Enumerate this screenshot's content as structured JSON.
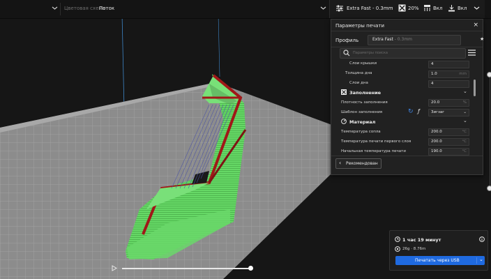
{
  "topbar": {
    "color_scheme_label": "Цветовая схема",
    "color_scheme_value": "Поток",
    "profile_summary": "Extra Fast - 0.3mm",
    "infill": "20%",
    "support": "Вкл",
    "adhesion": "Вкл",
    "icons": [
      "chevron-down-icon",
      "sliders-icon",
      "infill-icon",
      "support-icon",
      "adhesion-icon"
    ]
  },
  "panel": {
    "title": "Параметры печати",
    "close": "×",
    "profile_label": "Профиль",
    "profile_name": "Extra Fast",
    "profile_layer": " - 0.3mm",
    "search_placeholder": "Параметры поиска",
    "rows_top": [
      {
        "label": "Слои крышки",
        "value": "4",
        "unit": ""
      },
      {
        "label": "Толщина дна",
        "value": "1.0",
        "unit": "mm"
      },
      {
        "label": "Слои дна",
        "value": "4",
        "unit": ""
      }
    ],
    "infill_section": {
      "title": "Заполнение",
      "rows": [
        {
          "label": "Плотность заполнения",
          "value": "20.0",
          "unit": "%"
        },
        {
          "label": "Шаблон заполнения",
          "value": "Зигзаг",
          "unit": ""
        }
      ]
    },
    "material_section": {
      "title": "Материал",
      "rows": [
        {
          "label": "Температура сопла",
          "value": "200.0",
          "unit": "°C"
        },
        {
          "label": "Температура печати первого слоя",
          "value": "200.0",
          "unit": "°C"
        },
        {
          "label": "Начальная температура печати",
          "value": "190.0",
          "unit": "°C"
        }
      ]
    },
    "recommended_button": "Рекомендован"
  },
  "summary": {
    "time": "1 час 19 минут",
    "weight": "26g · 8.76m",
    "print_button": "Печатать через USB"
  },
  "colors": {
    "accent": "#1f6ae0",
    "model_green": "#5fd35f",
    "model_red": "#b01818",
    "build_plate": "#8a8a8a"
  }
}
